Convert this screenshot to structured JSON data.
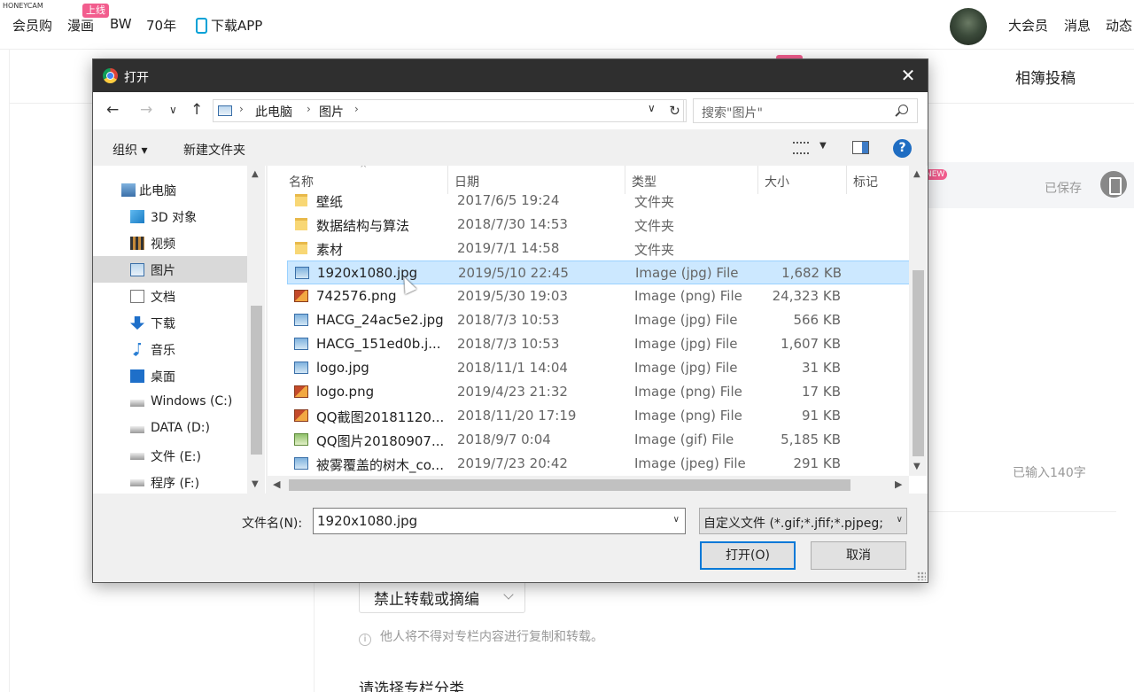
{
  "watermark": "HONEYCAM",
  "topnav": {
    "items": [
      "会员购",
      "漫画",
      "BW",
      "70年",
      "下载APP"
    ],
    "manga_badge": "上线",
    "right": [
      "大会员",
      "消息",
      "动态"
    ]
  },
  "background": {
    "page_title": "相簿投稿",
    "saved": "已保存",
    "new_badge": "NEW",
    "char_count": "已输入140字",
    "repost_select": "禁止转载或摘编",
    "repost_hint": "他人将不得对专栏内容进行复制和转载。",
    "category_label": "请选择专栏分类"
  },
  "dialog": {
    "title": "打开",
    "breadcrumb": [
      "此电脑",
      "图片"
    ],
    "search_placeholder": "搜索\"图片\"",
    "toolbar": {
      "organize": "组织",
      "new_folder": "新建文件夹"
    },
    "tree": [
      {
        "label": "此电脑",
        "icon": "pc-icon"
      },
      {
        "label": "3D 对象",
        "icon": "cube-icon"
      },
      {
        "label": "视频",
        "icon": "video-icon"
      },
      {
        "label": "图片",
        "icon": "pictures-icon",
        "selected": true
      },
      {
        "label": "文档",
        "icon": "document-icon"
      },
      {
        "label": "下载",
        "icon": "download-icon"
      },
      {
        "label": "音乐",
        "icon": "music-icon"
      },
      {
        "label": "桌面",
        "icon": "desktop-icon"
      },
      {
        "label": "Windows (C:)",
        "icon": "drive-icon"
      },
      {
        "label": "DATA (D:)",
        "icon": "drive-icon"
      },
      {
        "label": "文件 (E:)",
        "icon": "drive-icon"
      },
      {
        "label": "程序 (F:)",
        "icon": "drive-icon"
      }
    ],
    "columns": [
      "名称",
      "日期",
      "类型",
      "大小",
      "标记"
    ],
    "files": [
      {
        "name": "壁纸",
        "date": "2017/6/5 19:24",
        "type": "文件夹",
        "size": "",
        "kind": "folder"
      },
      {
        "name": "数据结构与算法",
        "date": "2018/7/30 14:53",
        "type": "文件夹",
        "size": "",
        "kind": "folder"
      },
      {
        "name": "素材",
        "date": "2019/7/1 14:58",
        "type": "文件夹",
        "size": "",
        "kind": "folder"
      },
      {
        "name": "1920x1080.jpg",
        "date": "2019/5/10 22:45",
        "type": "Image (jpg) File",
        "size": "1,682 KB",
        "kind": "jpg",
        "selected": true
      },
      {
        "name": "742576.png",
        "date": "2019/5/30 19:03",
        "type": "Image (png) File",
        "size": "24,323 KB",
        "kind": "png"
      },
      {
        "name": "HACG_24ac5e2.jpg",
        "date": "2018/7/3 10:53",
        "type": "Image (jpg) File",
        "size": "566 KB",
        "kind": "jpg"
      },
      {
        "name": "HACG_151ed0b.j...",
        "date": "2018/7/3 10:53",
        "type": "Image (jpg) File",
        "size": "1,607 KB",
        "kind": "jpg"
      },
      {
        "name": "logo.jpg",
        "date": "2018/11/1 14:04",
        "type": "Image (jpg) File",
        "size": "31 KB",
        "kind": "jpg"
      },
      {
        "name": "logo.png",
        "date": "2019/4/23 21:32",
        "type": "Image (png) File",
        "size": "17 KB",
        "kind": "png"
      },
      {
        "name": "QQ截图20181120...",
        "date": "2018/11/20 17:19",
        "type": "Image (png) File",
        "size": "91 KB",
        "kind": "png"
      },
      {
        "name": "QQ图片20180907...",
        "date": "2018/9/7 0:04",
        "type": "Image (gif) File",
        "size": "5,185 KB",
        "kind": "gif"
      },
      {
        "name": "被雾覆盖的树木_co...",
        "date": "2019/7/23 20:42",
        "type": "Image (jpeg) File",
        "size": "291 KB",
        "kind": "jpg"
      }
    ],
    "filename_label": "文件名(N):",
    "filename_value": "1920x1080.jpg",
    "filetype_value": "自定义文件 (*.gif;*.jfif;*.pjpeg;",
    "open_button": "打开(O)",
    "cancel_button": "取消"
  }
}
